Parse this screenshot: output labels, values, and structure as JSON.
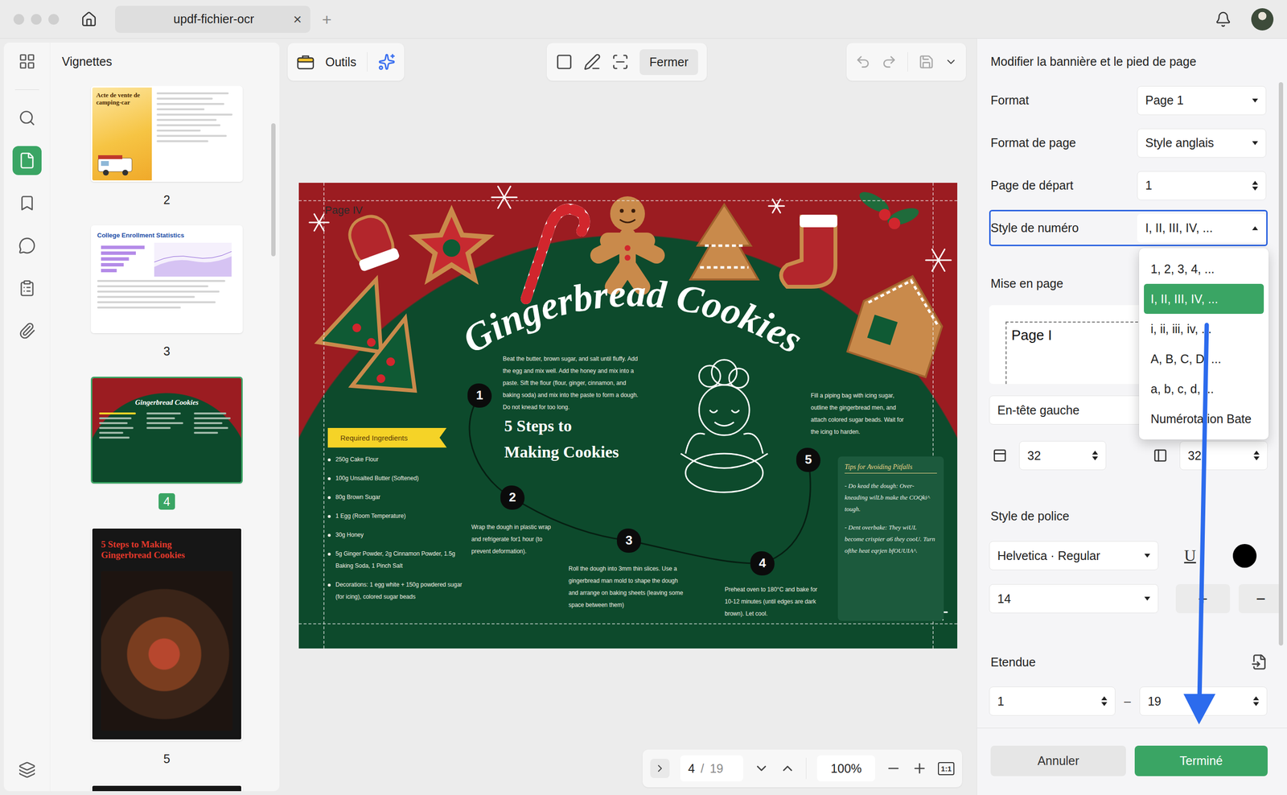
{
  "window": {
    "tab": {
      "label": "updf-fichier-ocr",
      "close": "×",
      "selected": true
    },
    "new_tab": "+"
  },
  "rail": {
    "items": [
      {
        "selected": false
      },
      {
        "selected": false
      },
      {
        "selected": true
      },
      {
        "selected": false
      },
      {
        "selected": false
      },
      {
        "selected": false
      },
      {
        "selected": false
      }
    ],
    "footer": {
      "selected": false
    }
  },
  "thumbnails": {
    "title": "Vignettes",
    "pages": [
      {
        "page": "2",
        "kind": "sale",
        "title": "Acte de vente de camping-car",
        "selected": false
      },
      {
        "page": "3",
        "kind": "chart",
        "title": "College Enrollment Statistics",
        "selected": false
      },
      {
        "page": "4",
        "kind": "recipe",
        "title": "Gingerbread Cookies",
        "selected": true
      },
      {
        "page": "5",
        "kind": "cover",
        "title": "5 Steps to Making Gingerbread Cookies",
        "selected": false
      },
      {
        "kind": "partial",
        "selected": false
      }
    ]
  },
  "toolbar": {
    "tools": "Outils",
    "close": "Fermer"
  },
  "document": {
    "header": "Page IV",
    "title": "Gingerbread Cookies",
    "subtitle": [
      "5 Steps to",
      "Making Cookies"
    ],
    "steps": [
      {
        "number": "1",
        "text": "Beat the butter, brown sugar, and salt until fluffy. Add the egg and mix well. Add the honey and mix into a paste. Sift the flour (flour, ginger, cinnamon, and baking soda) and mix into the paste to form a dough. Do not knead for too long."
      },
      {
        "number": "2",
        "text": "Wrap the dough in plastic wrap and refrigerate for1 hour (to prevent deformation)."
      },
      {
        "number": "3",
        "text": "Roll the dough into 3mm thin slices. Use a gingerbread man mold to shape the dough and arrange on baking sheets (leaving some space between them)"
      },
      {
        "number": "4",
        "text": "Preheat oven to 180°C and bake for 10-12 minutes (until edges are dark brown). Let cool."
      },
      {
        "number": "5",
        "text": "Fill a piping bag with icing sugar, outline the gingerbread men, and attach colored sugar beads. Wait for the icing to harden."
      }
    ],
    "ingredients": {
      "label": "Required Ingredients",
      "items": [
        "250g Cake Flour",
        "100g Unsalted Butter (Softened)",
        "80g Brown Sugar",
        "1 Egg (Room Temperature)",
        "30g Honey",
        "5g Ginger Powder, 2g Cinnamon Powder, 1.5g Baking Soda, 1 Pinch Salt",
        "Decorations: 1 egg white + 150g powdered sugar (for icing), colored sugar beads"
      ]
    },
    "tips": {
      "title": "Tips for Avoiding Pitfalls",
      "items": [
        "- Do kead the dough: Over-kneading wilLb make the COQki^ tough.",
        "- Dent overbake: They wiUL become crispier a6 they cooU. Turn ofthe heat eqrjen bfOUUIA^."
      ]
    }
  },
  "pager": {
    "page": "4",
    "separator": "/",
    "total": "19",
    "zoom": "100%",
    "actual_size": "1:1"
  },
  "panel": {
    "title": "Modifier la bannière et le pied de page",
    "fields": [
      {
        "label": "Format",
        "value": "Page 1",
        "kind": "select",
        "focused": false,
        "open": false
      },
      {
        "label": "Format de page",
        "value": "Style anglais",
        "kind": "select",
        "focused": false,
        "open": false
      },
      {
        "label": "Page de départ",
        "value": "1",
        "kind": "stepper",
        "focused": false,
        "open": false
      },
      {
        "label": "Style de numéro",
        "value": "I, II, III, IV, ...",
        "kind": "select",
        "focused": true,
        "open": true
      }
    ],
    "dropdown": [
      {
        "label": "1, 2, 3, 4, ...",
        "selected": false
      },
      {
        "label": "I, II, III, IV, ...",
        "selected": true
      },
      {
        "label": "i, ii, iii, iv, ...",
        "selected": false
      },
      {
        "label": "A, B, C, D, ...",
        "selected": false
      },
      {
        "label": "a, b, c, d, ...",
        "selected": false
      },
      {
        "label": "Numérotation Bate",
        "selected": false
      }
    ],
    "layout": {
      "title": "Mise en page",
      "preview": "Page I",
      "position": "En-tête gauche",
      "margin_top": "32",
      "margin_side": "32"
    },
    "font": {
      "title": "Style de police",
      "family": "Helvetica · Regular",
      "underline": "U",
      "color": "#000000",
      "size": "14",
      "plus": "+",
      "minus": "−"
    },
    "range": {
      "title": "Etendue",
      "from": "1",
      "dash": "–",
      "to": "19"
    },
    "buttons": [
      {
        "label": "Annuler",
        "kind": "secondary"
      },
      {
        "label": "Terminé",
        "kind": "primary"
      }
    ]
  }
}
